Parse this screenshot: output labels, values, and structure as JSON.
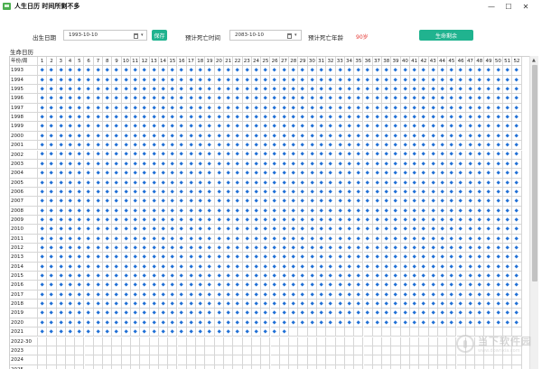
{
  "window": {
    "title": "人生日历 时间所剩不多",
    "minimize": "—",
    "maximize": "☐",
    "close": "✕"
  },
  "toolbar": {
    "birth_label": "出生日期",
    "birth_value": "1993-10-10",
    "save_label": "保存",
    "death_label": "预计死亡时间",
    "death_value": "2083-10-10",
    "age_label": "预计死亡年龄",
    "age_value": "90岁",
    "remaining_label": "生命剩余"
  },
  "calendar": {
    "title": "生命日历",
    "corner_header": "年份/周",
    "weeks": [
      "1",
      "2",
      "3",
      "4",
      "5",
      "6",
      "7",
      "8",
      "9",
      "10",
      "11",
      "12",
      "13",
      "14",
      "15",
      "16",
      "17",
      "18",
      "19",
      "20",
      "21",
      "22",
      "23",
      "24",
      "25",
      "26",
      "27",
      "28",
      "29",
      "30",
      "31",
      "32",
      "33",
      "34",
      "35",
      "36",
      "37",
      "38",
      "39",
      "40",
      "41",
      "42",
      "43",
      "44",
      "45",
      "46",
      "47",
      "48",
      "49",
      "50",
      "51",
      "52"
    ],
    "rows": [
      {
        "year": "1993",
        "filled": 52
      },
      {
        "year": "1994",
        "filled": 52
      },
      {
        "year": "1995",
        "filled": 52
      },
      {
        "year": "1996",
        "filled": 52
      },
      {
        "year": "1997",
        "filled": 52
      },
      {
        "year": "1998",
        "filled": 52
      },
      {
        "year": "1999",
        "filled": 52
      },
      {
        "year": "2000",
        "filled": 52
      },
      {
        "year": "2001",
        "filled": 52
      },
      {
        "year": "2002",
        "filled": 52
      },
      {
        "year": "2003",
        "filled": 52
      },
      {
        "year": "2004",
        "filled": 52
      },
      {
        "year": "2005",
        "filled": 52
      },
      {
        "year": "2006",
        "filled": 52
      },
      {
        "year": "2007",
        "filled": 52
      },
      {
        "year": "2008",
        "filled": 52
      },
      {
        "year": "2009",
        "filled": 52
      },
      {
        "year": "2010",
        "filled": 52
      },
      {
        "year": "2011",
        "filled": 52
      },
      {
        "year": "2012",
        "filled": 52
      },
      {
        "year": "2013",
        "filled": 52
      },
      {
        "year": "2014",
        "filled": 52
      },
      {
        "year": "2015",
        "filled": 52
      },
      {
        "year": "2016",
        "filled": 52
      },
      {
        "year": "2017",
        "filled": 52
      },
      {
        "year": "2018",
        "filled": 52
      },
      {
        "year": "2019",
        "filled": 52
      },
      {
        "year": "2020",
        "filled": 52
      },
      {
        "year": "2021",
        "filled": 27
      },
      {
        "year": "2022-30",
        "filled": 0
      },
      {
        "year": "2023",
        "filled": 0
      },
      {
        "year": "2024",
        "filled": 0
      },
      {
        "year": "2025",
        "filled": 0
      }
    ]
  },
  "watermark": {
    "cn": "当下软件园",
    "en": "www.downxia.com"
  },
  "colors": {
    "accent": "#20b38f",
    "diamond": "#1f6fd6",
    "age": "#e53935"
  }
}
